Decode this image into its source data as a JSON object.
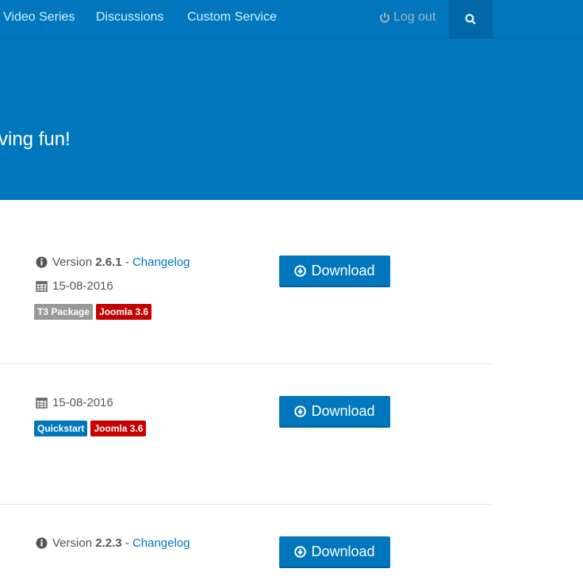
{
  "nav": {
    "items": [
      "Video Series",
      "Discussions",
      "Custom Service"
    ],
    "logout": "Log out"
  },
  "hero": {
    "text": "ving fun!"
  },
  "colors": {
    "primary": "#0077bd",
    "tag_gray": "#999999",
    "tag_red": "#c40000"
  },
  "downloads": [
    {
      "version_label": "Version",
      "version": "2.6.1",
      "sep": "-",
      "changelog": "Changelog",
      "date": "15-08-2016",
      "tags": [
        "T3 Package",
        "Joomla 3.6"
      ],
      "button": "Download"
    },
    {
      "date": "15-08-2016",
      "tags": [
        "Quickstart",
        "Joomla 3.6"
      ],
      "button": "Download"
    },
    {
      "version_label": "Version",
      "version": "2.2.3",
      "sep": "-",
      "changelog": "Changelog",
      "button": "Download"
    }
  ]
}
